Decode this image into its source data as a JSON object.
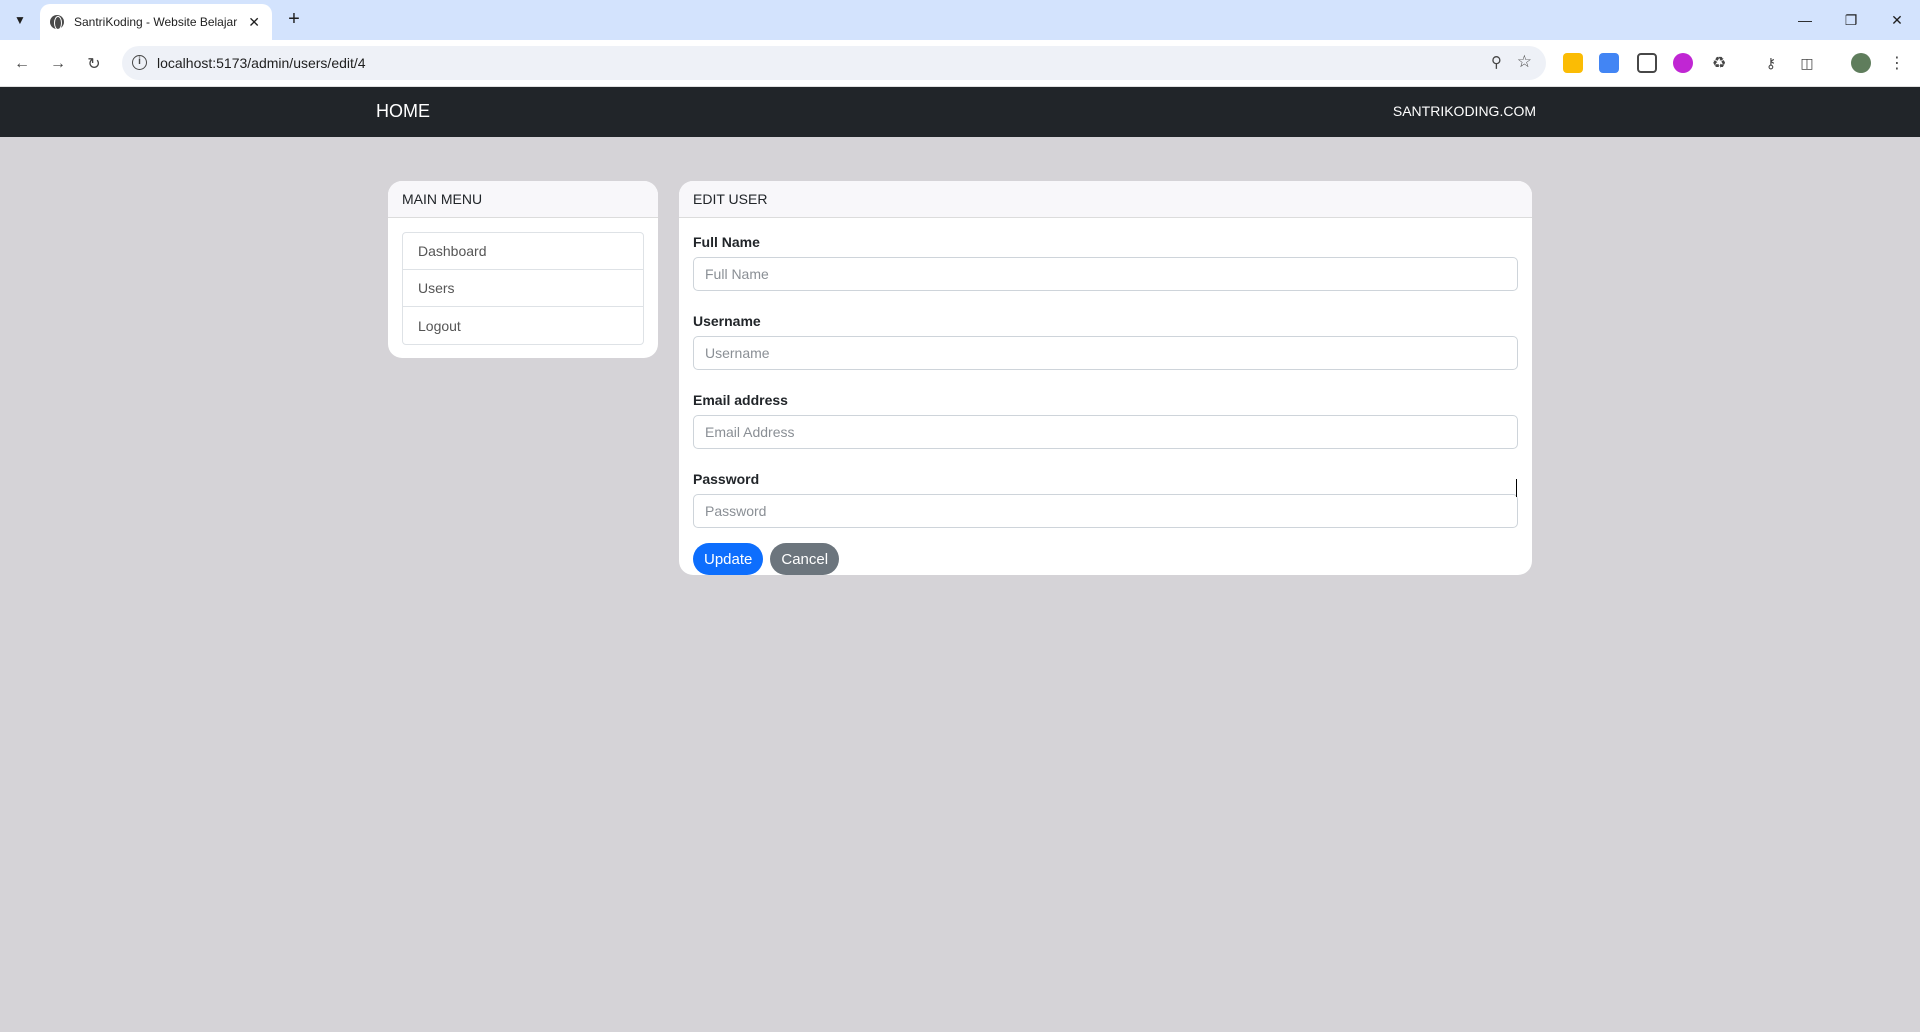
{
  "browser": {
    "tab_title": "SantriKoding - Website Belajar",
    "url": "localhost:5173/admin/users/edit/4",
    "colors": {
      "tabbar": "#d3e3fd",
      "toolbar": "#ffffff"
    }
  },
  "navbar": {
    "brand": "HOME",
    "site_link": "SANTRIKODING.COM",
    "background": "#212529"
  },
  "sidebar": {
    "header": "MAIN MENU",
    "items": [
      {
        "label": "Dashboard"
      },
      {
        "label": "Users"
      },
      {
        "label": "Logout"
      }
    ]
  },
  "form": {
    "header": "EDIT USER",
    "fields": [
      {
        "label": "Full Name",
        "placeholder": "Full Name",
        "value": ""
      },
      {
        "label": "Username",
        "placeholder": "Username",
        "value": ""
      },
      {
        "label": "Email address",
        "placeholder": "Email Address",
        "value": ""
      },
      {
        "label": "Password",
        "placeholder": "Password",
        "value": ""
      }
    ],
    "update_label": "Update",
    "cancel_label": "Cancel",
    "colors": {
      "primary": "#0d6efd",
      "secondary": "#6c757d"
    }
  }
}
